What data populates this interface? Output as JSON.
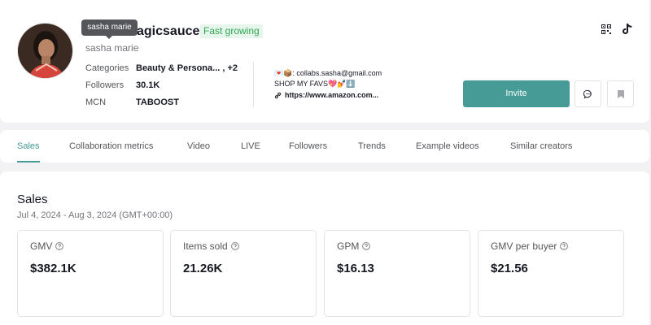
{
  "profile": {
    "tooltip": "sasha marie",
    "handle_visible": "agicsauce",
    "badge": "Fast growing",
    "nickname": "sasha marie",
    "categories_label": "Categories",
    "categories_value": "Beauty & Persona... , +2",
    "followers_label": "Followers",
    "followers_value": "30.1K",
    "mcn_label": "MCN",
    "mcn_value": "TABOOST",
    "bio_line1": "💌📦: collabs.sasha@gmail.com",
    "bio_line2": "SHOP MY FAVS💖💅⬇️",
    "bio_link": "https://www.amazon.com...",
    "invite_label": "Invite",
    "accent_color": "#469b96"
  },
  "tabs": [
    {
      "label": "Sales",
      "active": true
    },
    {
      "label": "Collaboration metrics",
      "active": false
    },
    {
      "label": "Video",
      "active": false
    },
    {
      "label": "LIVE",
      "active": false
    },
    {
      "label": "Followers",
      "active": false
    },
    {
      "label": "Trends",
      "active": false
    },
    {
      "label": "Example videos",
      "active": false
    },
    {
      "label": "Similar creators",
      "active": false
    }
  ],
  "sales": {
    "title": "Sales",
    "date_range": "Jul 4, 2024 - Aug 3, 2024 (GMT+00:00)",
    "metrics": [
      {
        "label": "GMV",
        "value": "$382.1K"
      },
      {
        "label": "Items sold",
        "value": "21.26K"
      },
      {
        "label": "GPM",
        "value": "$16.13"
      },
      {
        "label": "GMV per buyer",
        "value": "$21.56"
      }
    ]
  },
  "icons": {
    "qr": "qr-code-icon",
    "tiktok": "tiktok-icon",
    "message": "message-icon",
    "bookmark": "bookmark-icon",
    "link": "link-icon",
    "info": "info-icon"
  }
}
